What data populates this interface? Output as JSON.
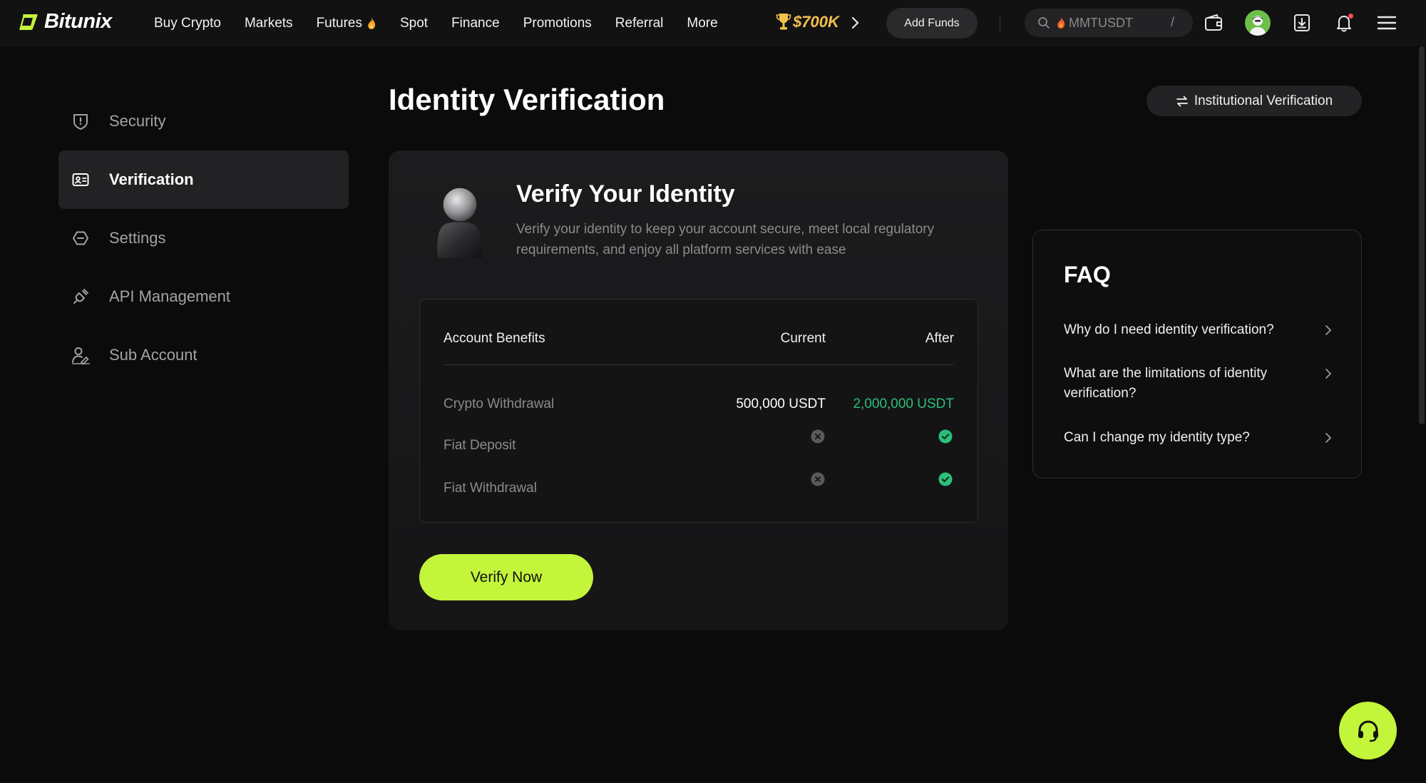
{
  "brand": {
    "name": "Bitunix",
    "accent": "#c3f53a",
    "success": "#2bbf7a"
  },
  "nav": {
    "items": [
      "Buy Crypto",
      "Markets",
      "Futures",
      "Spot",
      "Finance",
      "Promotions",
      "Referral",
      "More"
    ],
    "promo": "$700K",
    "add_funds": "Add Funds",
    "search_placeholder": "MMTUSDT",
    "search_shortcut": "/"
  },
  "sidebar": {
    "items": [
      {
        "label": "Security",
        "icon": "shield-icon",
        "active": false
      },
      {
        "label": "Verification",
        "icon": "id-card-icon",
        "active": true
      },
      {
        "label": "Settings",
        "icon": "settings-icon",
        "active": false
      },
      {
        "label": "API Management",
        "icon": "api-key-icon",
        "active": false
      },
      {
        "label": "Sub Account",
        "icon": "sub-account-icon",
        "active": false
      }
    ]
  },
  "main": {
    "title": "Identity Verification",
    "institutional_button": "Institutional Verification",
    "card": {
      "title": "Verify Your Identity",
      "description": "Verify your identity to keep your account secure, meet local regulatory requirements, and enjoy all platform services with ease",
      "table": {
        "headers": [
          "Account Benefits",
          "Current",
          "After"
        ],
        "rows": [
          {
            "label": "Crypto Withdrawal",
            "current": "500,000 USDT",
            "after": "2,000,000 USDT"
          },
          {
            "label": "Fiat Deposit",
            "current": "not-available-icon",
            "after": "available-icon"
          },
          {
            "label": "Fiat Withdrawal",
            "current": "not-available-icon",
            "after": "available-icon"
          }
        ]
      },
      "verify_button": "Verify Now"
    }
  },
  "faq": {
    "title": "FAQ",
    "items": [
      "Why do I need identity verification?",
      "What are the limitations of identity verification?",
      "Can I change my identity type?"
    ]
  }
}
